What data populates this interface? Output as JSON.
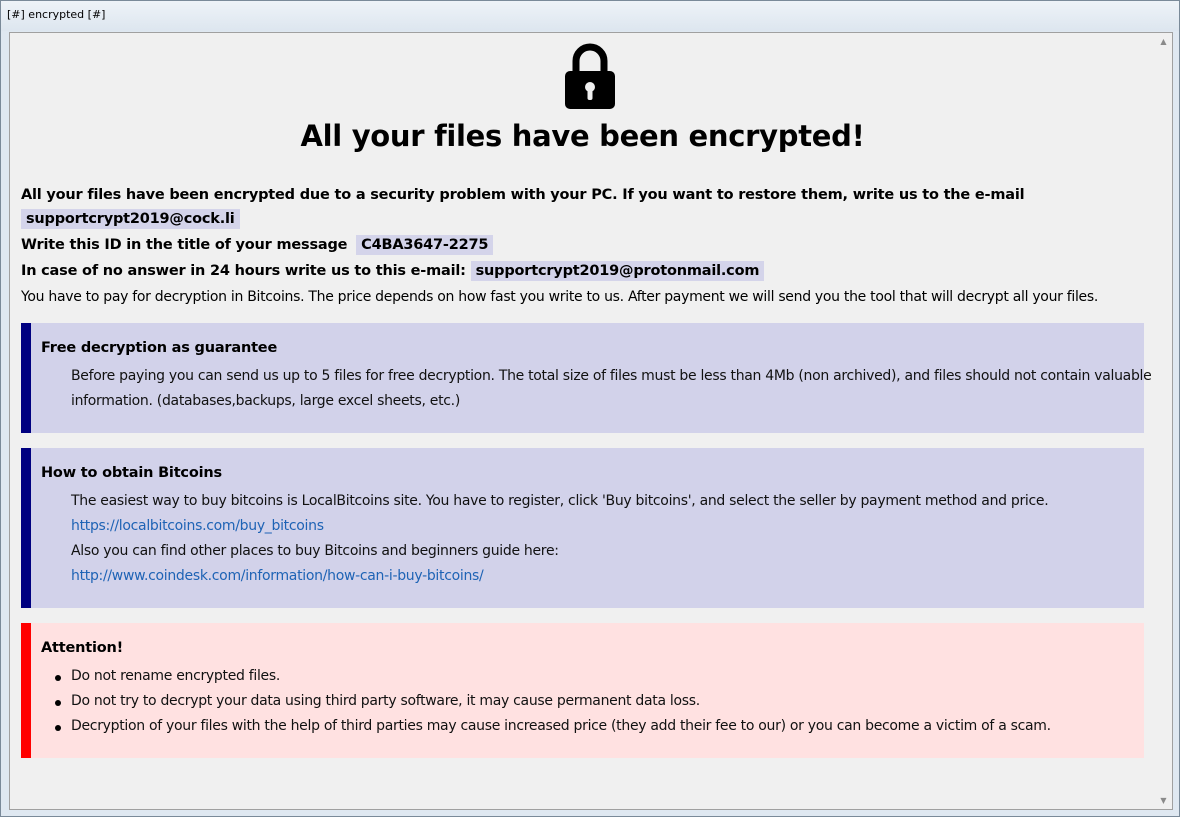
{
  "window": {
    "title": "[#] encrypted [#]"
  },
  "header": {
    "lock_icon": "padlock-icon",
    "headline": "All your files have been encrypted!"
  },
  "intro": {
    "line1": "All your files have been encrypted due to a security problem with your PC. If you want to restore them, write us to the e-mail",
    "email_primary": "supportcrypt2019@cock.li",
    "id_label": "Write this ID in the title of your message",
    "id_value": "C4BA3647-2275",
    "fallback_label": "In case of no answer in 24 hours write us to this e-mail:",
    "email_fallback": "supportcrypt2019@protonmail.com",
    "payment_text": "You have to pay for decryption in Bitcoins. The price depends on how fast you write to us. After payment we will send you the tool that will decrypt all your files."
  },
  "guarantee": {
    "title": "Free decryption as guarantee",
    "line1": "Before paying you can send us up to 5 files for free decryption. The total size of files must be less than 4Mb (non archived), and files should not contain valuable",
    "line2": "information. (databases,backups, large excel sheets, etc.)"
  },
  "bitcoins": {
    "title": "How to obtain Bitcoins",
    "line1": "The easiest way to buy bitcoins is LocalBitcoins site. You have to register, click 'Buy bitcoins', and select the seller by payment method and price.",
    "link1": "https://localbitcoins.com/buy_bitcoins",
    "line2": "Also you can find other places to buy Bitcoins and beginners guide here:",
    "link2": "http://www.coindesk.com/information/how-can-i-buy-bitcoins/"
  },
  "attention": {
    "title": "Attention!",
    "items": [
      "Do not rename encrypted files.",
      "Do not try to decrypt your data using third party software, it may cause permanent data loss.",
      "Decryption of your files with the help of third parties may cause increased price (they add their fee to our) or you can become a victim of a scam."
    ]
  },
  "colors": {
    "highlight": "#d4d4ea",
    "panel_blue": "#d2d2ea",
    "accent_blue": "#000080",
    "panel_red": "#ffe1e1",
    "accent_red": "#ff0000",
    "link": "#1e63b5"
  }
}
